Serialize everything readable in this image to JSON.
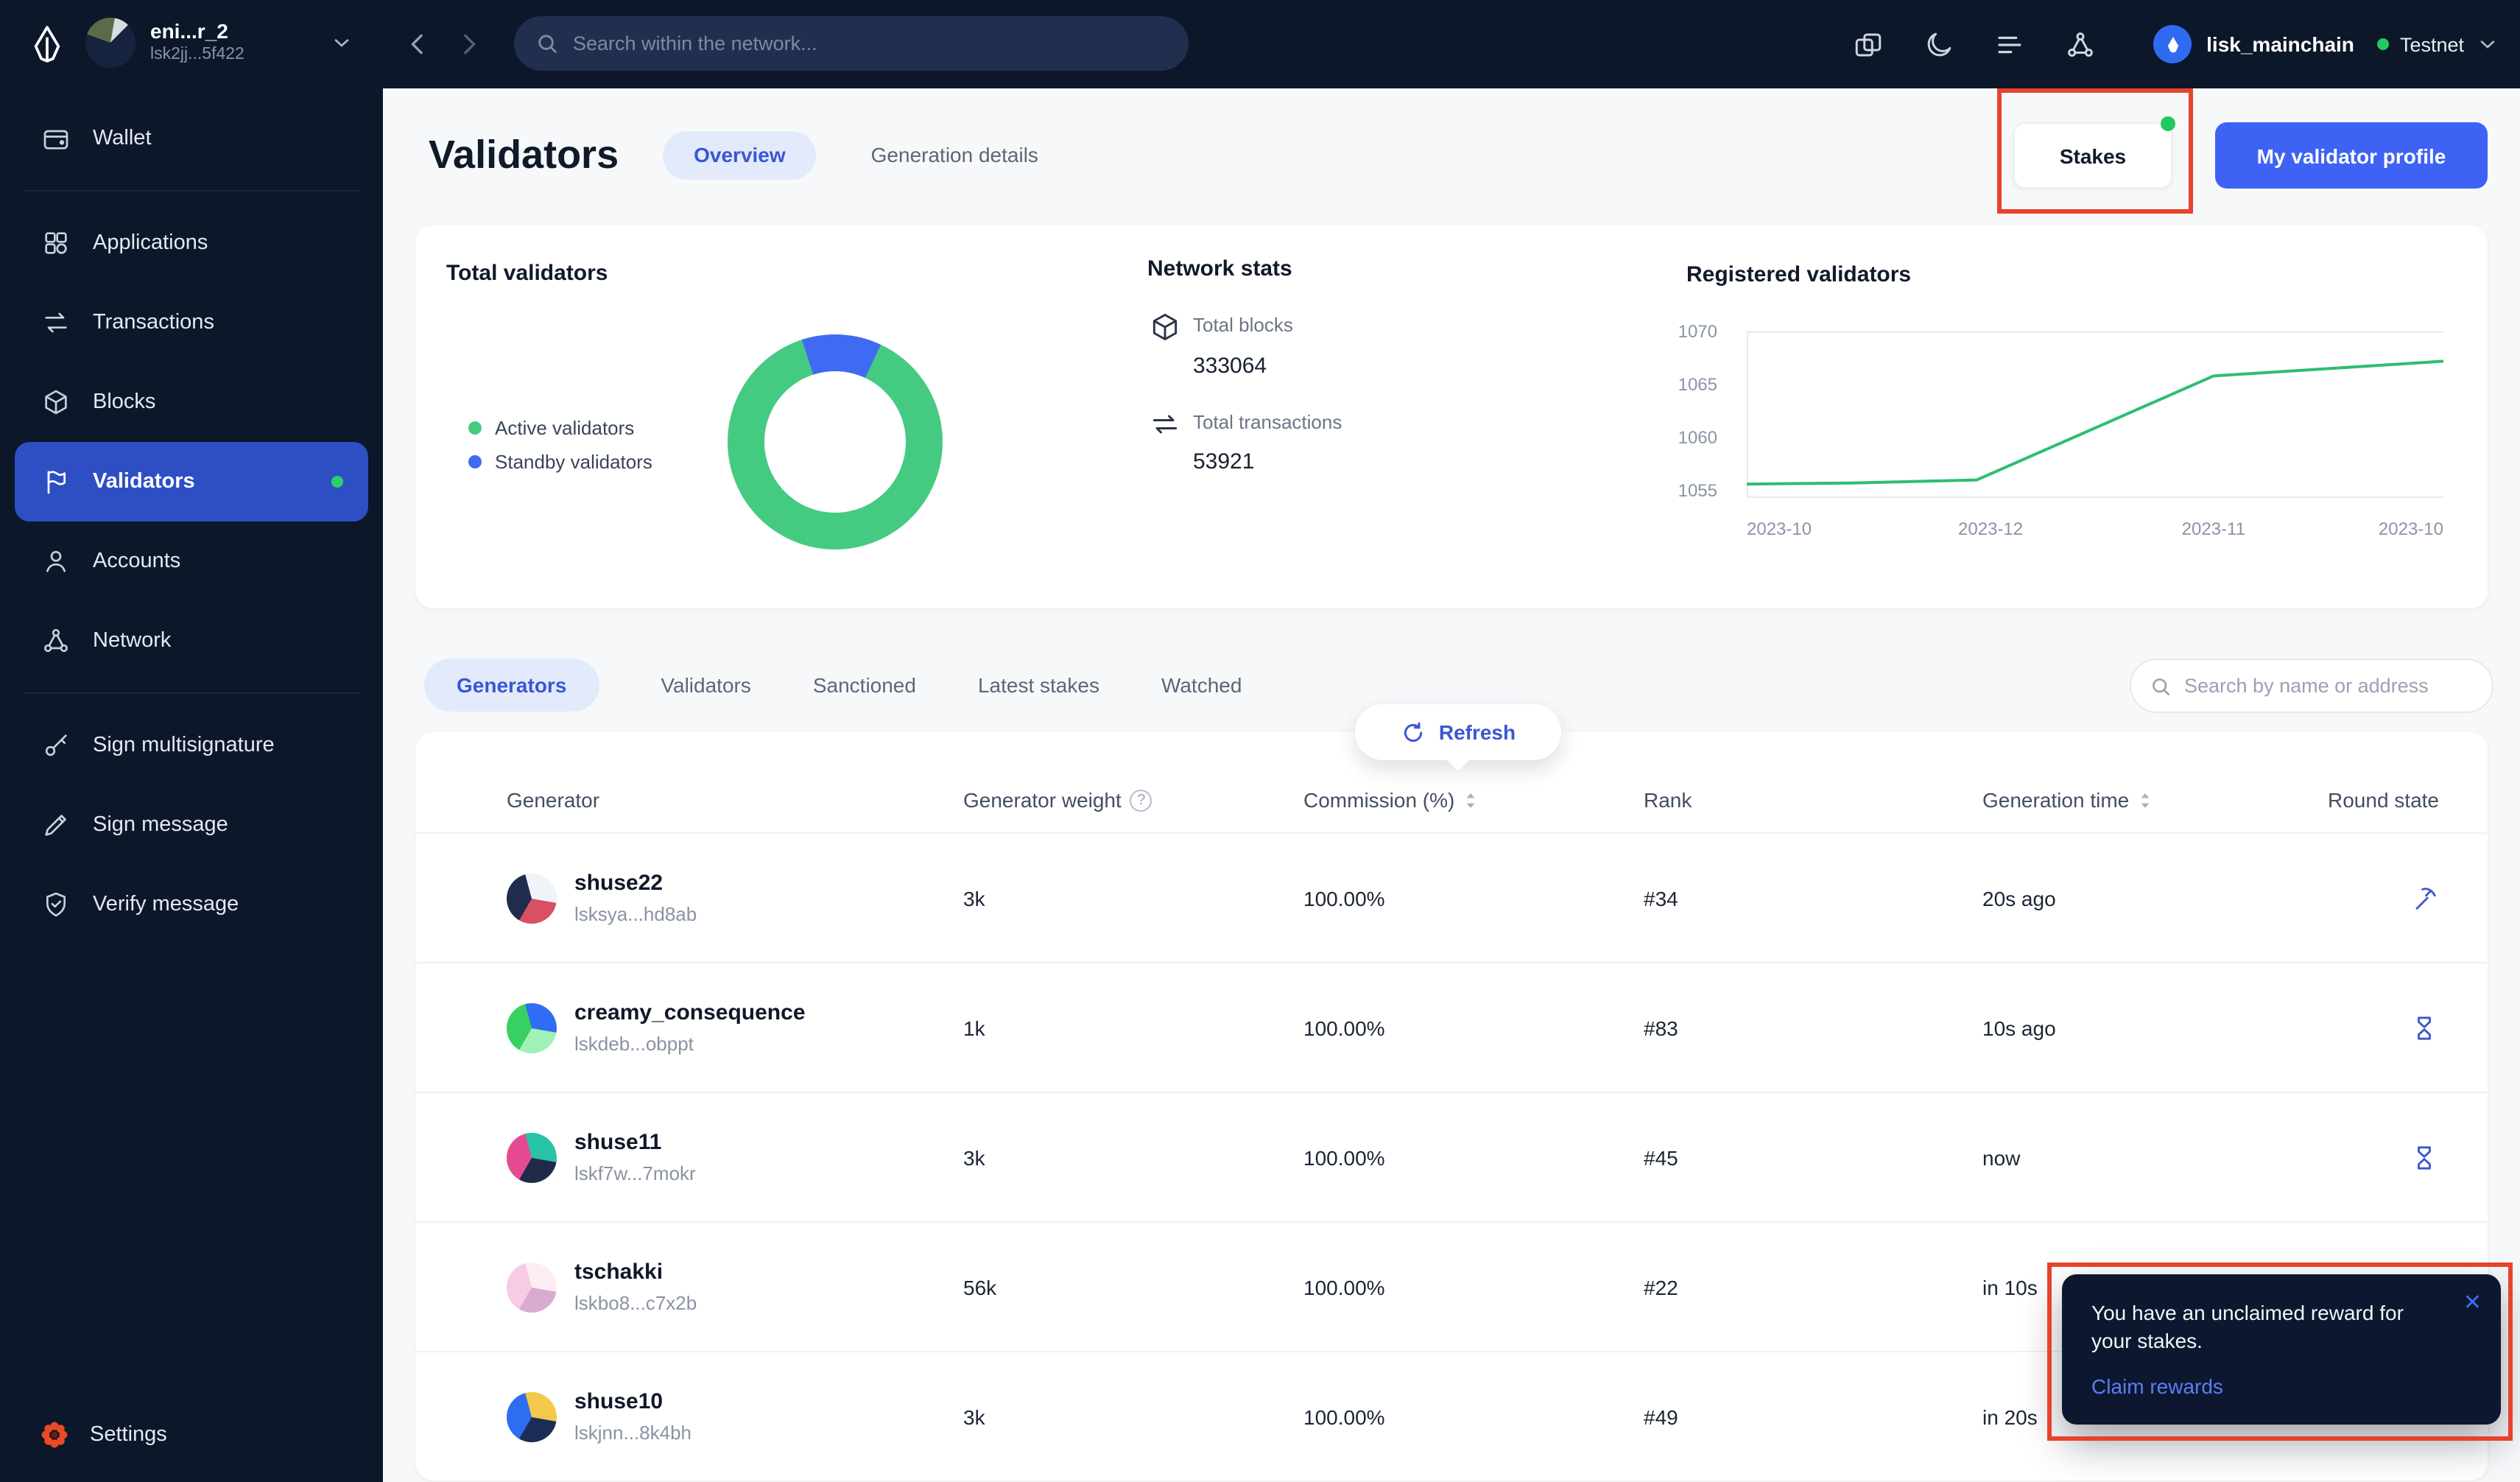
{
  "topbar": {
    "network_switcher": {
      "name": "eni...r_2",
      "address": "lsk2jj...5f422",
      "avatar_colors": [
        "#16233f",
        "#5b6b4a",
        "#d8dce2"
      ]
    },
    "search": {
      "placeholder": "Search within the network..."
    },
    "account": {
      "name": "lisk_mainchain",
      "network_label": "Testnet"
    }
  },
  "sidebar": {
    "items": [
      {
        "label": "Wallet"
      },
      {
        "label": "Applications"
      },
      {
        "label": "Transactions"
      },
      {
        "label": "Blocks"
      },
      {
        "label": "Validators",
        "active": true
      },
      {
        "label": "Accounts"
      },
      {
        "label": "Network"
      },
      {
        "label": "Sign multisignature"
      },
      {
        "label": "Sign message"
      },
      {
        "label": "Verify message"
      }
    ],
    "settings_label": "Settings"
  },
  "page": {
    "title": "Validators",
    "tabs": [
      "Overview",
      "Generation details"
    ],
    "stakes_button": "Stakes",
    "profile_button": "My validator profile"
  },
  "stats": {
    "total_validators_title": "Total validators",
    "network_stats": {
      "title": "Network stats",
      "total_blocks_label": "Total blocks",
      "total_blocks_value": "333064",
      "total_transactions_label": "Total transactions",
      "total_transactions_value": "53921"
    },
    "registered_validators_title": "Registered validators"
  },
  "chart_data": [
    {
      "type": "pie",
      "subtype": "donut",
      "title": "Total validators",
      "labels": [
        "Active validators",
        "Standby validators"
      ],
      "values": [
        88,
        12
      ],
      "colors": [
        "#45CB81",
        "#3E6BF2"
      ],
      "legend_position": "left"
    },
    {
      "type": "line",
      "title": "Registered validators",
      "x_ticks": [
        "2023-10",
        "2023-12",
        "2023-11",
        "2023-10"
      ],
      "y_ticks": [
        "1070",
        "1065",
        "1060",
        "1055"
      ],
      "ylim": [
        1054.3,
        1070
      ],
      "points": [
        {
          "x": 0.0,
          "y": 1055.6
        },
        {
          "x": 0.15,
          "y": 1055.7
        },
        {
          "x": 0.33,
          "y": 1056.0
        },
        {
          "x": 0.67,
          "y": 1065.8
        },
        {
          "x": 1.0,
          "y": 1067.2
        }
      ],
      "color": "#2EBE70",
      "grid": "top, left and bottom axis lines only"
    }
  ],
  "filters": {
    "tabs": [
      "Generators",
      "Validators",
      "Sanctioned",
      "Latest stakes",
      "Watched"
    ],
    "active_tab": "Generators",
    "search_placeholder": "Search by name or address",
    "refresh_button": "Refresh"
  },
  "table": {
    "columns": [
      "Generator",
      "Generator weight",
      "Commission (%)",
      "Rank",
      "Generation time",
      "Round state"
    ],
    "rows": [
      {
        "name": "shuse22",
        "address": "lsksya...hd8ab",
        "weight": "3k",
        "commission": "100.00%",
        "rank": "#34",
        "generation_time": "20s ago",
        "round_state": "generating",
        "avatar_colors": [
          "#202c4e",
          "#f0f3f7",
          "#d94f63"
        ]
      },
      {
        "name": "creamy_consequence",
        "address": "lskdeb...obppt",
        "weight": "1k",
        "commission": "100.00%",
        "rank": "#83",
        "generation_time": "10s ago",
        "round_state": "awaiting",
        "avatar_colors": [
          "#37d063",
          "#2f6df5",
          "#9ff2b5"
        ]
      },
      {
        "name": "shuse11",
        "address": "lskf7w...7mokr",
        "weight": "3k",
        "commission": "100.00%",
        "rank": "#45",
        "generation_time": "now",
        "round_state": "awaiting",
        "avatar_colors": [
          "#e64b92",
          "#28c2a6",
          "#222a49"
        ]
      },
      {
        "name": "tschakki",
        "address": "lskbo8...c7x2b",
        "weight": "56k",
        "commission": "100.00%",
        "rank": "#22",
        "generation_time": "in 10s",
        "round_state": null,
        "avatar_colors": [
          "#f6cbe4",
          "#fdeef6",
          "#d8abd0"
        ]
      },
      {
        "name": "shuse10",
        "address": "lskjnn...8k4bh",
        "weight": "3k",
        "commission": "100.00%",
        "rank": "#49",
        "generation_time": "in 20s",
        "round_state": null,
        "avatar_colors": [
          "#2e6cf2",
          "#f2c94c",
          "#1b2d55"
        ]
      }
    ]
  },
  "toast": {
    "message": "You have an unclaimed reward for your stakes.",
    "link": "Claim rewards",
    "close_icon": "✕"
  },
  "annotations": {
    "color": "#E8432C",
    "boxes": [
      "around stakes button",
      "around reward toast"
    ]
  }
}
